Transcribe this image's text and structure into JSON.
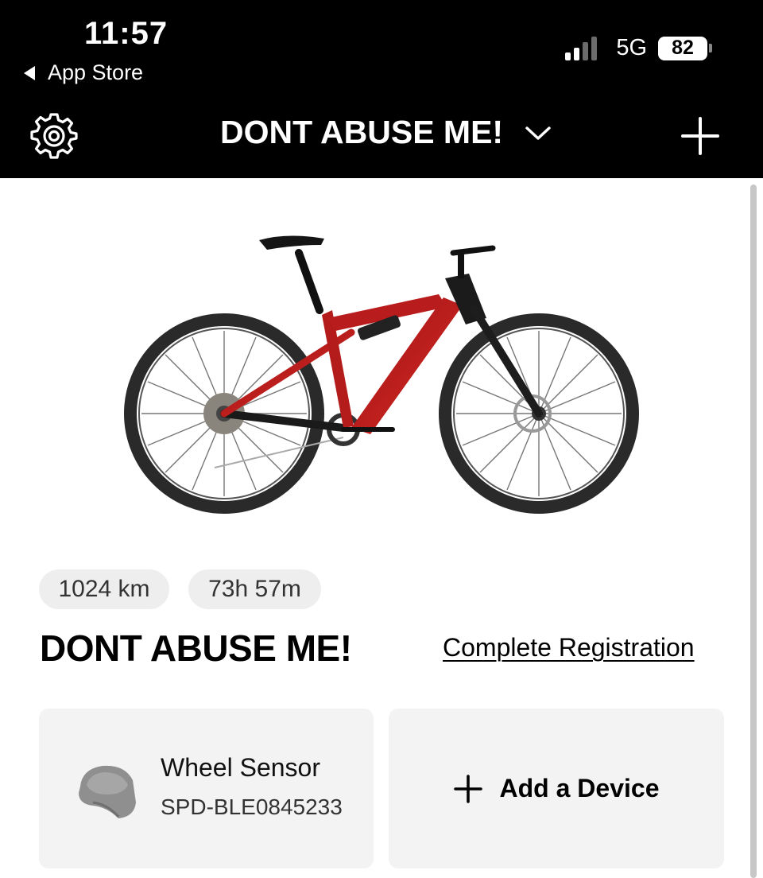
{
  "status_bar": {
    "time": "11:57",
    "back_label": "App Store",
    "network": "5G",
    "battery": "82"
  },
  "header": {
    "title": "DONT ABUSE ME!"
  },
  "bike": {
    "name": "DONT ABUSE ME!",
    "distance": "1024 km",
    "ride_time": "73h 57m",
    "register_label": "Complete Registration"
  },
  "devices": {
    "sensor_name": "Wheel Sensor",
    "sensor_id": "SPD-BLE0845233",
    "add_label": "Add a Device"
  },
  "icons": {
    "settings": "gear-icon",
    "dropdown": "chevron-down-icon",
    "add_bike": "plus-icon",
    "add_device": "plus-icon",
    "sensor": "wheel-sensor-icon"
  },
  "colors": {
    "header_bg": "#000000",
    "frame_red": "#c41e1e",
    "card_bg": "#f3f3f3",
    "chip_bg": "#eeeeee"
  }
}
